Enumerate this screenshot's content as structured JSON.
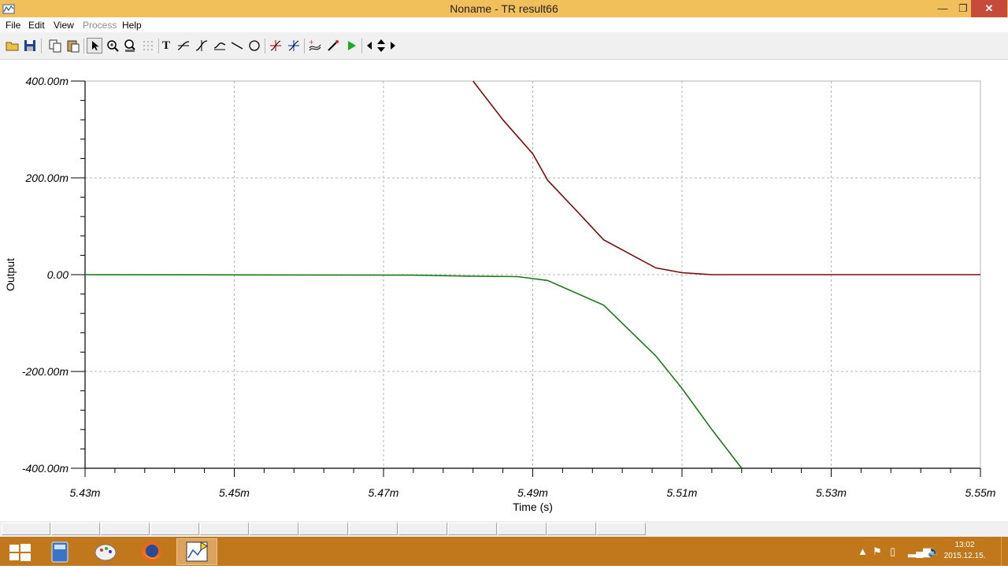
{
  "window": {
    "title": "Noname - TR result66",
    "minimize": "—",
    "maximize": "❐",
    "close": "✕"
  },
  "menu": [
    {
      "label": "File",
      "enabled": true
    },
    {
      "label": "Edit",
      "enabled": true
    },
    {
      "label": "View",
      "enabled": true
    },
    {
      "label": "Process",
      "enabled": false
    },
    {
      "label": "Help",
      "enabled": true
    }
  ],
  "toolbar": {
    "open": "open-folder-icon",
    "save": "save-icon",
    "copy": "copy-icon",
    "paste": "paste-icon",
    "select": "pointer-icon",
    "zoom_in": "zoom-in-icon",
    "zoom_100": "zoom-100-icon",
    "grid": "grid-icon",
    "text": "T",
    "tools": [
      "curve-tool-1-icon",
      "curve-tool-2-icon",
      "curve-tool-3-icon",
      "line-icon",
      "circle-icon",
      "cursor-a-icon",
      "cursor-b-icon",
      "curve-add-icon",
      "probe-icon",
      "run-icon",
      "pan-left-icon",
      "pan-vertical-icon",
      "pan-right-icon"
    ]
  },
  "chart_data": {
    "type": "line",
    "title": "",
    "xlabel": "Time (s)",
    "ylabel": "Output",
    "xlim": [
      0.00543,
      0.00555
    ],
    "ylim": [
      -0.4,
      0.4
    ],
    "x_ticks": [
      0.00543,
      0.00545,
      0.00547,
      0.00549,
      0.00551,
      0.00553,
      0.00555
    ],
    "x_tick_labels": [
      "5.43m",
      "5.45m",
      "5.47m",
      "5.49m",
      "5.51m",
      "5.53m",
      "5.55m"
    ],
    "y_ticks": [
      0.4,
      0.2,
      0.0,
      -0.2,
      -0.4
    ],
    "y_tick_labels": [
      "400.00m",
      "200.00m",
      "0.00",
      "-200.00m",
      "-400.00m"
    ],
    "grid": true,
    "series": [
      {
        "color": "#7b0c0c",
        "x": [
          0.005482,
          0.005486,
          0.00549,
          0.005492,
          0.005496,
          0.0054995,
          0.005503,
          0.0054995,
          0.0055065,
          0.00551,
          0.005514,
          0.00552,
          0.00555
        ],
        "y": [
          0.4,
          0.32,
          0.25,
          0.195,
          0.13,
          0.072,
          0.045,
          0.072,
          0.014,
          0.004,
          0.0,
          0.0,
          0.0
        ],
        "order": "sorted"
      },
      {
        "color": "#1a7a1a",
        "x": [
          0.00543,
          0.005474,
          0.005481,
          0.005488,
          0.005492,
          0.0054995,
          0.0055065,
          0.00551,
          0.005514,
          0.005518
        ],
        "y": [
          0.0,
          -0.001,
          -0.003,
          -0.004,
          -0.012,
          -0.063,
          -0.168,
          -0.235,
          -0.32,
          -0.4
        ]
      }
    ]
  },
  "statusbar_cells": 13,
  "taskbar": {
    "apps": [
      "start-icon",
      "calculator-icon",
      "paint-icon",
      "firefox-icon",
      "tina-analysis-icon"
    ],
    "clock": {
      "time": "13:02",
      "date": "2015.12.15."
    }
  },
  "colors": {
    "titlebar": "#f2c05a",
    "taskbar": "#c1781c",
    "grid": "#b5b5b5"
  }
}
